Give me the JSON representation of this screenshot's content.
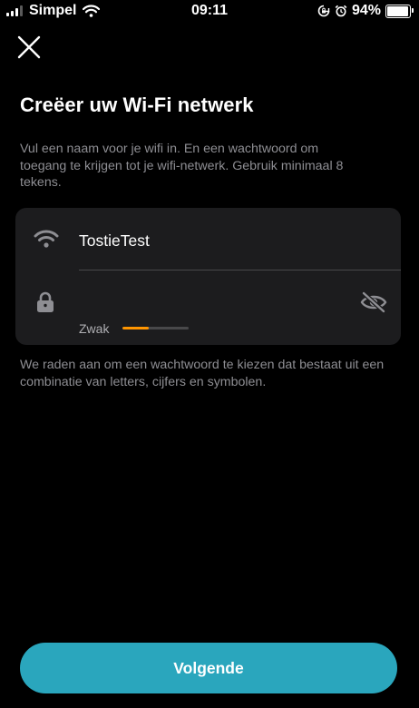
{
  "status_bar": {
    "carrier": "Simpel",
    "time": "09:11",
    "battery_percent": "94%",
    "battery_level": 0.94,
    "signal_bars_filled": 3,
    "signal_bars_total": 4,
    "icons": [
      "signal-icon",
      "wifi-status-icon",
      "rotation-lock-icon",
      "alarm-icon",
      "battery-icon"
    ]
  },
  "header": {
    "close_icon": "close-icon",
    "title": "Creëer uw Wi-Fi netwerk"
  },
  "intro_text": "Vul een naam voor je wifi in. En een wachtwoord om toegang te krijgen tot je wifi-netwerk. Gebruik minimaal 8 tekens.",
  "form": {
    "ssid": {
      "icon": "wifi-icon",
      "value": "TostieTest"
    },
    "password": {
      "icon": "lock-icon",
      "value": "",
      "toggle_icon": "eye-slash-icon",
      "strength_label": "Zwak",
      "strength_level": 0.4,
      "strength_color": "#ff9500"
    }
  },
  "advice_text": "We raden aan om een wachtwoord te kiezen dat bestaat uit een combinatie van letters, cijfers en symbolen.",
  "primary_button": {
    "label": "Volgende",
    "color": "#2aa6bd"
  },
  "colors": {
    "background": "#000000",
    "card": "#1c1c1e",
    "secondary_text": "#8e8e93"
  }
}
